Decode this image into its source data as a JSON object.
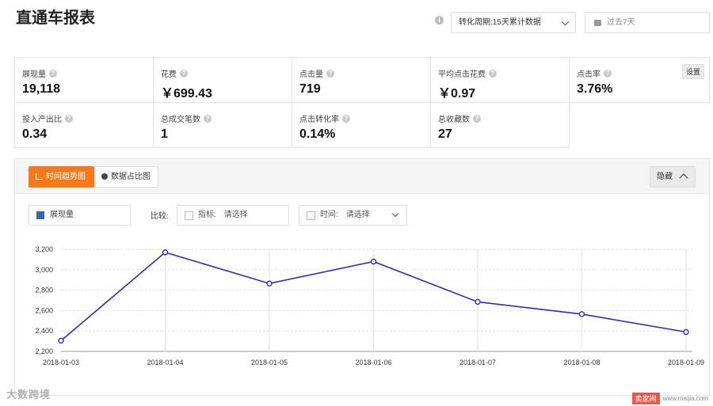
{
  "header": {
    "title": "直通车报表",
    "period_select": "转化周期:15天累计数据",
    "date_range": "过去7天"
  },
  "metrics": [
    {
      "label": "展现量",
      "value": "19,118"
    },
    {
      "label": "花费",
      "value": "￥699.43"
    },
    {
      "label": "点击量",
      "value": "719"
    },
    {
      "label": "平均点击花费",
      "value": "￥0.97"
    },
    {
      "label": "点击率",
      "value": "3.76%"
    },
    {
      "label": "投入产出比",
      "value": "0.34"
    },
    {
      "label": "总成交笔数",
      "value": "1"
    },
    {
      "label": "点击转化率",
      "value": "0.14%"
    },
    {
      "label": "总收藏数",
      "value": "27"
    }
  ],
  "settings_label": "设置",
  "chart_panel": {
    "tab_trend": "时间趋势图",
    "tab_pie": "数据占比图",
    "hide_label": "隐藏",
    "series_selected": "展现量",
    "compare_label": "比较:",
    "metric_label": "指标:",
    "metric_placeholder": "请选择",
    "time_label": "时间:",
    "time_placeholder": "请选择"
  },
  "chart_data": {
    "type": "line",
    "x": [
      "2018-01-03",
      "2018-01-04",
      "2018-01-05",
      "2018-01-06",
      "2018-01-07",
      "2018-01-08",
      "2018-01-09"
    ],
    "series": [
      {
        "name": "展现量",
        "values": [
          2305,
          3170,
          2865,
          3080,
          2685,
          2565,
          2390
        ],
        "color": "#3b2aa6"
      }
    ],
    "yticks": [
      "2,200",
      "2,400",
      "2,600",
      "2,800",
      "3,000",
      "3,200"
    ],
    "ylim": [
      2200,
      3200
    ],
    "grid": true
  },
  "watermark": {
    "left": "大数跨境",
    "right_brand": "卖家网",
    "right_url": "www.maijia.com"
  }
}
